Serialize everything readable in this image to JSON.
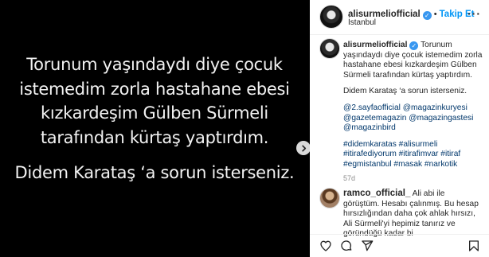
{
  "post_image": {
    "line1": "Torunum yaşındaydı diye çocuk istemedim zorla hastahane ebesi kızkardeşim Gülben Sürmeli tarafından kürtaş yaptırdım.",
    "line2": "Didem Karataş ‘a sorun isterseniz."
  },
  "header": {
    "username": "alisurmeliofficial",
    "follow_label": "Takip Et",
    "location": "İstanbul"
  },
  "caption": {
    "username": "alisurmeliofficial",
    "text": "Torunum yaşındaydı diye çocuk istemedim zorla hastahane ebesi kızkardeşim Gülben Sürmeli tarafından kürtaş yaptırdım.",
    "text2": "Didem Karataş ‘a sorun isterseniz.",
    "mentions": "@2.sayfaofficial @magazinkuryesi @gazetemagazin @magazingastesi @magazinbird",
    "hashtags": "#didemkaratas #alisurmeli #itirafediyorum #itirafimvar #itiraf #egmistanbul #masak #narkotik",
    "age": "57d"
  },
  "comment": {
    "username": "ramco_official_",
    "text": "Ali abi ile görüştüm. Hesabı çalınmış. Bu hesap hırsızlığından daha çok ahlak hırsızı, Ali Sürmeli'yi hepimiz tanırız ve göründüğü kadar bi"
  },
  "icons": {
    "verified": "verified-badge-icon",
    "more": "more-options-icon",
    "next": "chevron-right-icon",
    "like": "heart-icon",
    "comment": "comment-icon",
    "share": "share-icon",
    "save": "bookmark-icon"
  },
  "colors": {
    "follow": "#0095f6",
    "verified": "#3897f0",
    "link": "#00376b",
    "image_bg": "#000000"
  }
}
